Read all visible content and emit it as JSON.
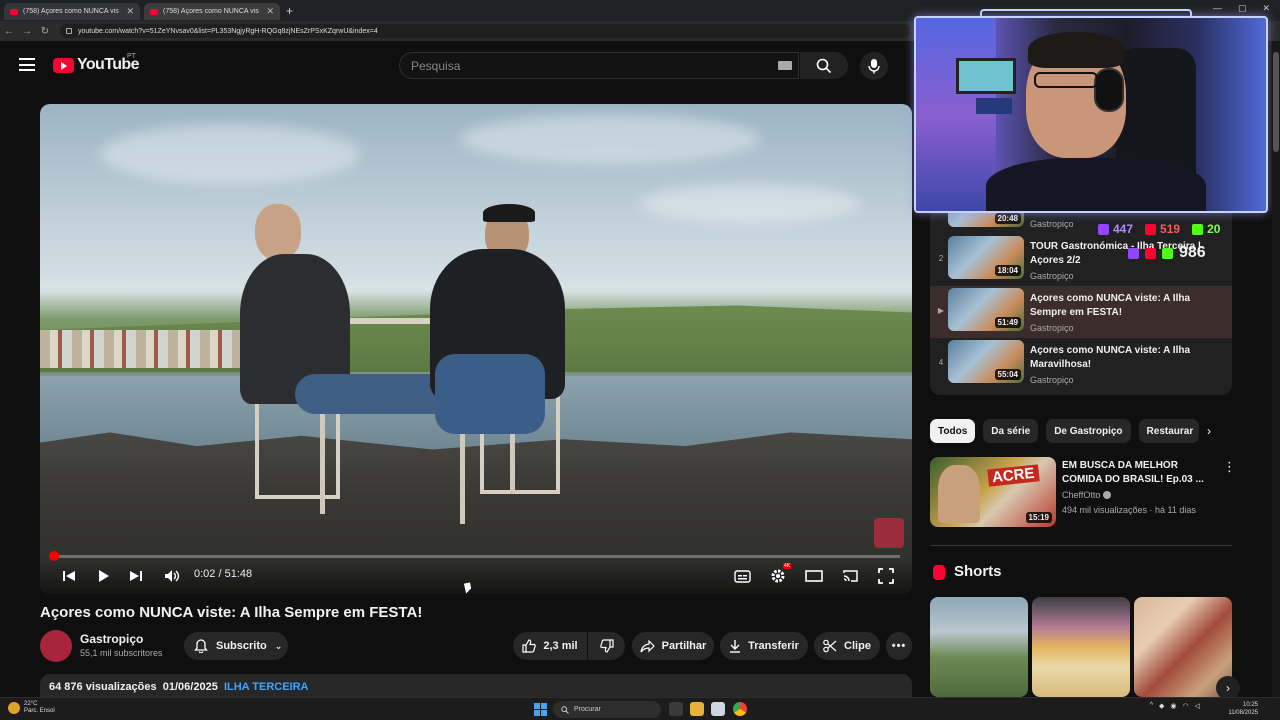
{
  "browser": {
    "tabs": [
      {
        "label": "(758) Açores como NUNCA vis"
      },
      {
        "label": "(758) Açores como NUNCA vis"
      }
    ],
    "url": "youtube.com/watch?v=51ZeYNvsav0&list=PL353NgjyRgH-RQGq8zjNEsZrPSxKZqrwU&index=4"
  },
  "header": {
    "logo_text": "YouTube",
    "region": "PT",
    "search_placeholder": "Pesquisa"
  },
  "player": {
    "time": "0:02 / 51:48",
    "progress_fraction": 0.0006,
    "quality_badge": "4K"
  },
  "video": {
    "title": "Açores como NUNCA viste: A Ilha Sempre em FESTA!",
    "channel": "Gastropiço",
    "subscribers": "55,1 mil subscritores",
    "subscribe_label": "Subscrito",
    "likes": "2,3 mil",
    "share_label": "Partilhar",
    "download_label": "Transferir",
    "clip_label": "Clipe",
    "views": "64 876 visualizações",
    "date": "01/06/2025",
    "tag": "ILHA TERCEIRA"
  },
  "playlist": {
    "items": [
      {
        "index": "",
        "duration": "20:48",
        "title": "",
        "channel": "Gastropiço"
      },
      {
        "index": "2",
        "duration": "18:04",
        "title": "TOUR Gastronómica - Ilha Terceira | Açores 2/2",
        "channel": "Gastropiço"
      },
      {
        "index": "▶",
        "duration": "51:49",
        "title": "Açores como NUNCA viste: A Ilha Sempre em FESTA!",
        "channel": "Gastropiço"
      },
      {
        "index": "4",
        "duration": "55:04",
        "title": "Açores como NUNCA viste: A Ilha Maravilhosa!",
        "channel": "Gastropiço"
      }
    ]
  },
  "chips": [
    "Todos",
    "Da série",
    "De Gastropiço",
    "Restaurar"
  ],
  "recommended": {
    "badge": "ACRE",
    "duration": "15:19",
    "title": "EM BUSCA DA MELHOR COMIDA DO BRASIL! Ep.03 ...",
    "channel": "CheffOtto",
    "meta": "494 mil visualizações · há 11 dias"
  },
  "shorts": {
    "title": "Shorts"
  },
  "stream_stats": {
    "twitch": "447",
    "youtube": "519",
    "kick": "20",
    "total": "986"
  },
  "taskbar": {
    "temperature": "22°C",
    "weather_text": "Parc. Ensol",
    "search_label": "Procurar",
    "time": "10:25",
    "date": "11/08/2025"
  },
  "colors": {
    "accent_red": "#ff0033",
    "link_blue": "#3ea6ff",
    "twitch_purple": "#9146ff",
    "kick_green": "#53fc18"
  }
}
